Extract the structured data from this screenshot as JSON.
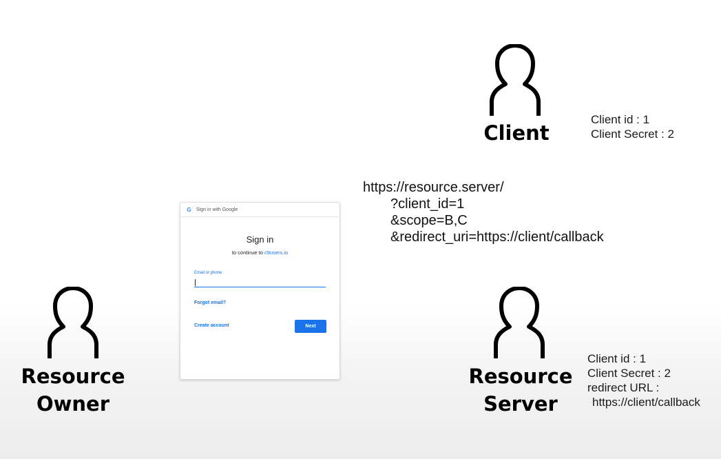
{
  "actors": {
    "client": {
      "label": "Client"
    },
    "resource_owner": {
      "label_line1": "Resource",
      "label_line2": "Owner"
    },
    "resource_server": {
      "label_line1": "Resource",
      "label_line2": "Server"
    }
  },
  "client_info": {
    "client_id": "Client id : 1",
    "client_secret": "Client Secret : 2"
  },
  "server_info": {
    "client_id": "Client id : 1",
    "client_secret": "Client Secret : 2",
    "redirect_label": "redirect URL :",
    "redirect_value": "https://client/callback"
  },
  "auth_url": {
    "base": "https://resource.server/",
    "client_id": "?client_id=1",
    "scope": "&scope=B,C",
    "redirect": "&redirect_uri=https://client/callback"
  },
  "signin": {
    "bar_icon": "G",
    "bar_text": "Sign in with Google",
    "title": "Sign in",
    "subtitle_prefix": "to continue to ",
    "subtitle_link": "c9users.io",
    "field_label": "Email or phone",
    "field_value": "",
    "forgot_label": "Forgot email?",
    "create_label": "Create account",
    "next_label": "Next"
  },
  "colors": {
    "link_blue": "#1a73e8",
    "text": "#000000"
  }
}
